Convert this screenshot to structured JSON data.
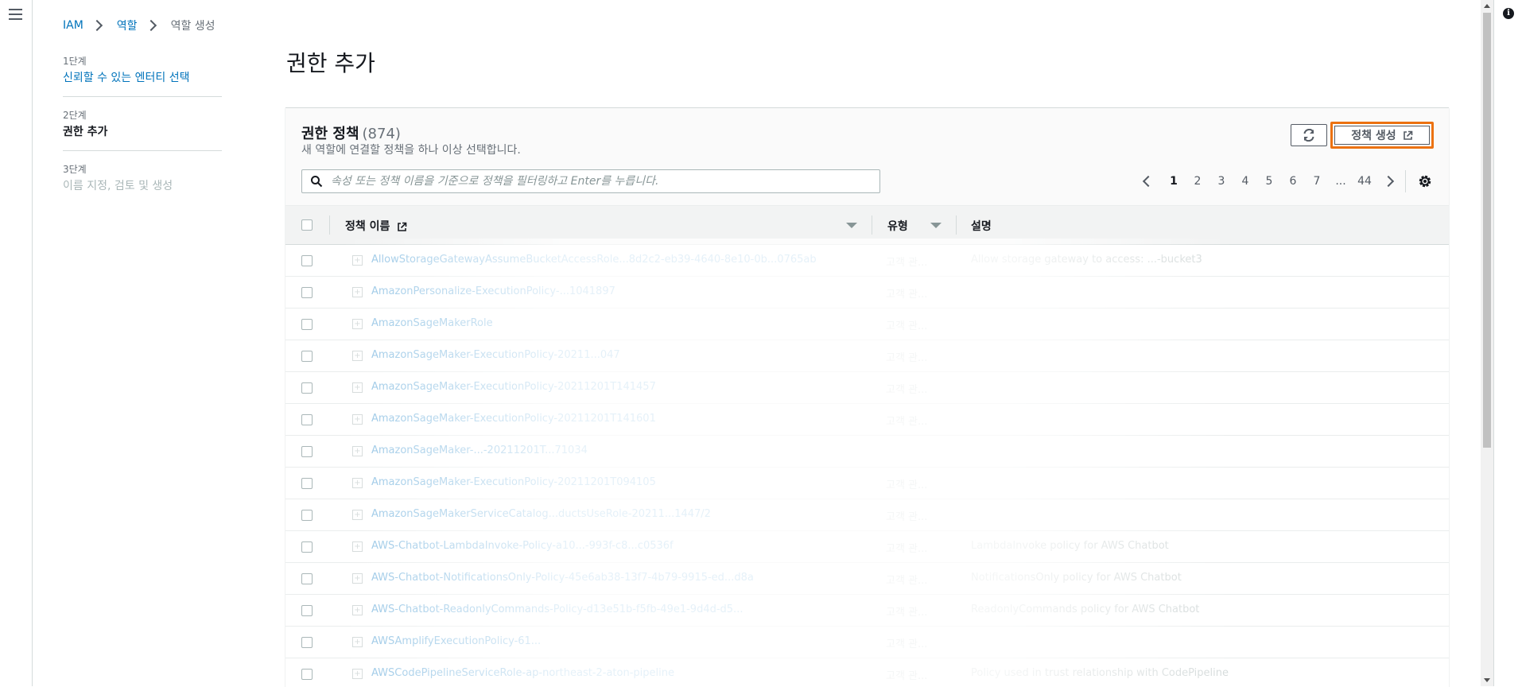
{
  "breadcrumb": {
    "root": "IAM",
    "roles": "역할",
    "current": "역할 생성"
  },
  "steps": [
    {
      "num": "1단계",
      "label": "신뢰할 수 있는 엔터티 선택",
      "state": "link"
    },
    {
      "num": "2단계",
      "label": "권한 추가",
      "state": "active"
    },
    {
      "num": "3단계",
      "label": "이름 지정, 검토 및 생성",
      "state": "disabled"
    }
  ],
  "page_title": "권한 추가",
  "policies": {
    "title": "권한 정책",
    "count": "(874)",
    "description": "새 역할에 연결할 정책을 하나 이상 선택합니다.",
    "create_button": "정책 생성",
    "search_placeholder": "속성 또는 정책 이름을 기준으로 정책을 필터링하고 Enter를 누릅니다.",
    "pagination": [
      "1",
      "2",
      "3",
      "4",
      "5",
      "6",
      "7",
      "...",
      "44"
    ],
    "current_page": "1",
    "columns": {
      "name": "정책 이름",
      "type": "유형",
      "description": "설명"
    },
    "rows": [
      {
        "name": "AllowStorageGatewayAssumeBucketAccessRole...8d2c2-eb39-4640-8e10-0b...0765ab",
        "type": "고객 관...",
        "desc": "Allow storage gateway to access: ...-bucket3"
      },
      {
        "name": "AmazonPersonalize-ExecutionPolicy-...1041897",
        "type": "고객 관...",
        "desc": ""
      },
      {
        "name": "AmazonSageMakerRole",
        "type": "고객 관...",
        "desc": ""
      },
      {
        "name": "AmazonSageMaker-ExecutionPolicy-20211...047",
        "type": "고객 관...",
        "desc": ""
      },
      {
        "name": "AmazonSageMaker-ExecutionPolicy-20211201T141457",
        "type": "고객 관...",
        "desc": ""
      },
      {
        "name": "AmazonSageMaker-ExecutionPolicy-20211201T141601",
        "type": "고객 관...",
        "desc": ""
      },
      {
        "name": "AmazonSageMaker-...-20211201T...71034",
        "type": "",
        "desc": ""
      },
      {
        "name": "AmazonSageMaker-ExecutionPolicy-20211201T094105",
        "type": "고객 관...",
        "desc": ""
      },
      {
        "name": "AmazonSageMakerServiceCatalog...ductsUseRole-20211...1447/2",
        "type": "고객 관...",
        "desc": ""
      },
      {
        "name": "AWS-Chatbot-LambdaInvoke-Policy-a10...-993f-c8...c0536f",
        "type": "고객 관...",
        "desc": "LambdaInvoke policy for AWS Chatbot"
      },
      {
        "name": "AWS-Chatbot-NotificationsOnly-Policy-45e6ab38-13f7-4b79-9915-ed...d8a",
        "type": "고객 관...",
        "desc": "NotificationsOnly policy for AWS Chatbot"
      },
      {
        "name": "AWS-Chatbot-ReadonlyCommands-Policy-d13e51b-f5fb-49e1-9d4d-d5...",
        "type": "고객 관...",
        "desc": "ReadonlyCommands policy for AWS Chatbot"
      },
      {
        "name": "AWSAmplifyExecutionPolicy-61...",
        "type": "고객 관...",
        "desc": ""
      },
      {
        "name": "AWSCodePipelineServiceRole-ap-northeast-2-aton-pipeline",
        "type": "고객 관...",
        "desc": "Policy used in trust relationship with CodePipeline"
      }
    ]
  },
  "colors": {
    "accent_orange": "#ec7211",
    "link_blue": "#0073bb"
  }
}
